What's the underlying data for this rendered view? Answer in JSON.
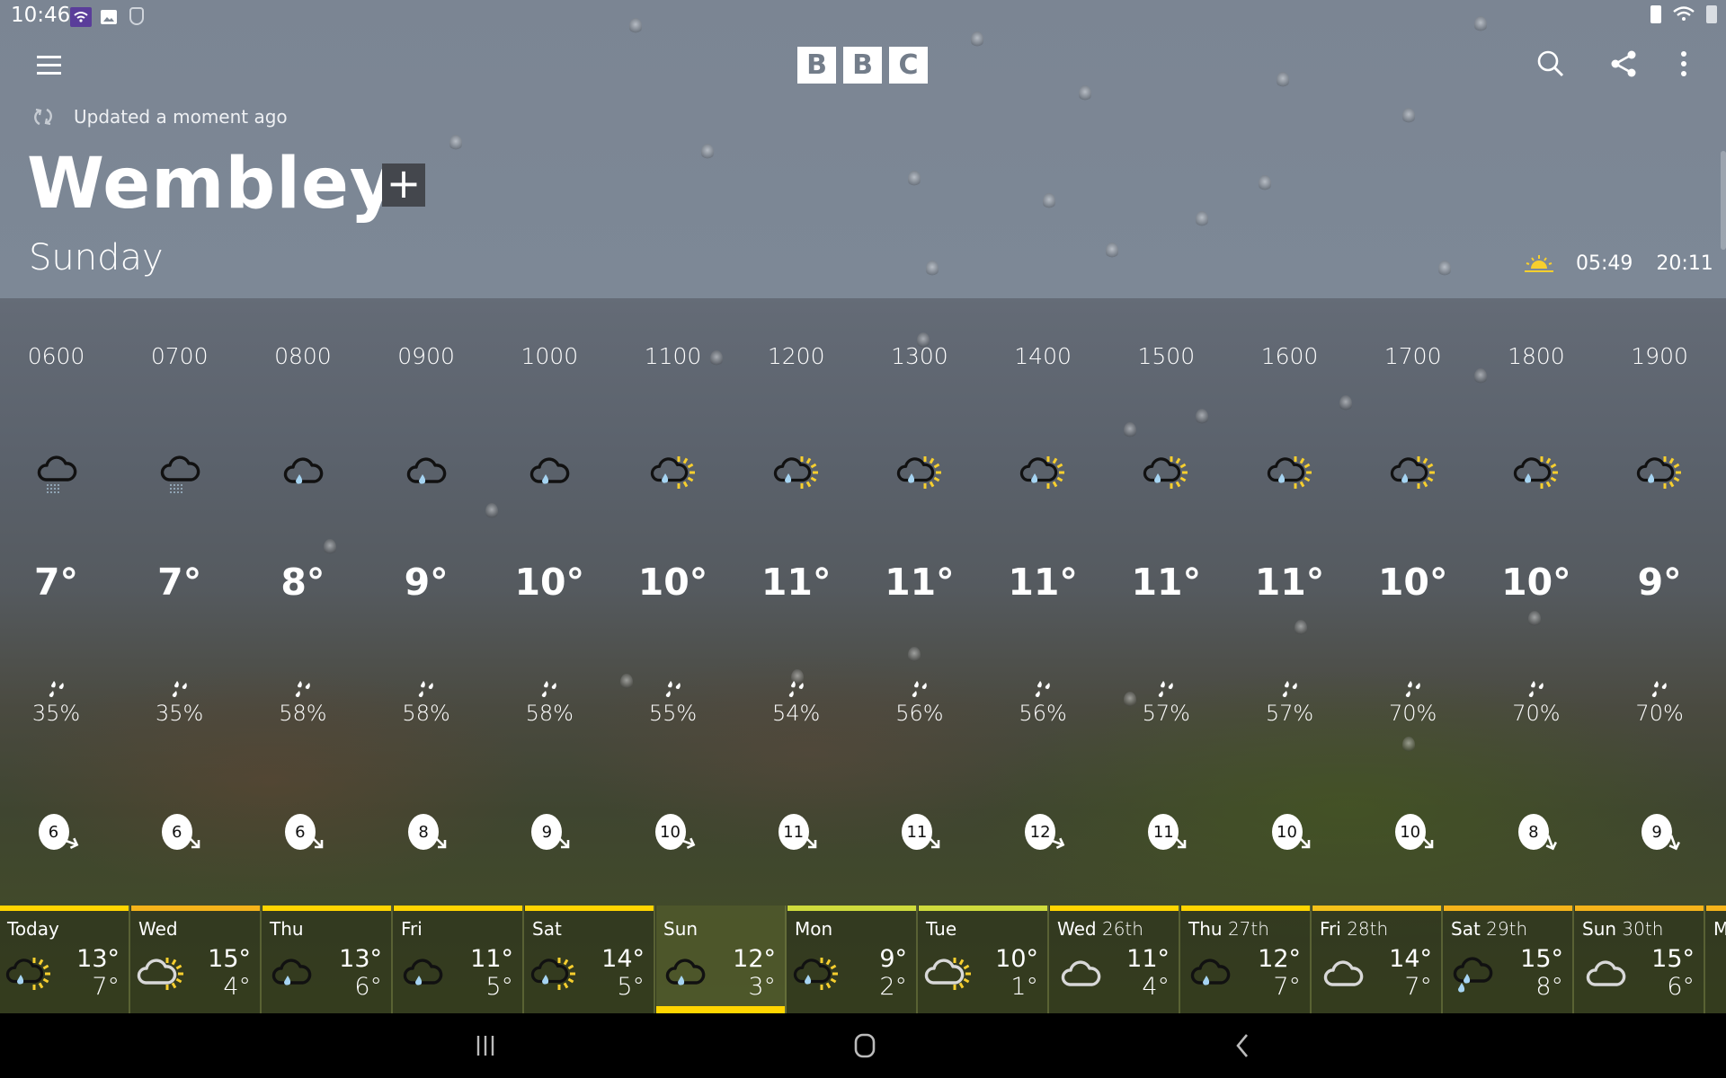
{
  "status_bar": {
    "time": "10:46",
    "icons": [
      "wifi-calling-icon",
      "image-icon",
      "vpn-shield-icon",
      "battery-saver-icon",
      "wifi-signal-icon",
      "battery-icon"
    ]
  },
  "app_bar": {
    "logo": [
      "B",
      "B",
      "C"
    ],
    "menu_icon": "hamburger-menu-icon",
    "search_icon": "search-icon",
    "share_icon": "share-icon",
    "more_icon": "more-vertical-icon"
  },
  "header": {
    "updated_text": "Updated a moment ago",
    "location": "Wembley",
    "add_label": "+",
    "day": "Sunday",
    "sunrise": "05:49",
    "sunset": "20:11"
  },
  "colors": {
    "accent_yellow": "#ffd500",
    "orange": "#f5b31a",
    "lime": "#cfdc3c",
    "rain_blue": "#a6d4f2"
  },
  "hourly": [
    {
      "time": "0600",
      "icon": "light-rain-cloud",
      "temp": "7°",
      "rain": "35%",
      "wind": "6",
      "wind_dir": 110
    },
    {
      "time": "0700",
      "icon": "light-rain-cloud",
      "temp": "7°",
      "rain": "35%",
      "wind": "6",
      "wind_dir": 135
    },
    {
      "time": "0800",
      "icon": "rain-cloud",
      "temp": "8°",
      "rain": "58%",
      "wind": "6",
      "wind_dir": 135
    },
    {
      "time": "0900",
      "icon": "rain-cloud",
      "temp": "9°",
      "rain": "58%",
      "wind": "8",
      "wind_dir": 135
    },
    {
      "time": "1000",
      "icon": "rain-cloud",
      "temp": "10°",
      "rain": "58%",
      "wind": "9",
      "wind_dir": 135
    },
    {
      "time": "1100",
      "icon": "sunny-rain-cloud",
      "temp": "10°",
      "rain": "55%",
      "wind": "10",
      "wind_dir": 110
    },
    {
      "time": "1200",
      "icon": "sunny-rain-cloud",
      "temp": "11°",
      "rain": "54%",
      "wind": "11",
      "wind_dir": 135
    },
    {
      "time": "1300",
      "icon": "sunny-rain-cloud",
      "temp": "11°",
      "rain": "56%",
      "wind": "11",
      "wind_dir": 135
    },
    {
      "time": "1400",
      "icon": "sunny-rain-cloud",
      "temp": "11°",
      "rain": "56%",
      "wind": "12",
      "wind_dir": 110
    },
    {
      "time": "1500",
      "icon": "sunny-rain-cloud",
      "temp": "11°",
      "rain": "57%",
      "wind": "11",
      "wind_dir": 135
    },
    {
      "time": "1600",
      "icon": "sunny-rain-cloud",
      "temp": "11°",
      "rain": "57%",
      "wind": "10",
      "wind_dir": 135
    },
    {
      "time": "1700",
      "icon": "sunny-rain-cloud",
      "temp": "10°",
      "rain": "70%",
      "wind": "10",
      "wind_dir": 135
    },
    {
      "time": "1800",
      "icon": "sunny-rain-cloud",
      "temp": "10°",
      "rain": "70%",
      "wind": "8",
      "wind_dir": 160
    },
    {
      "time": "1900",
      "icon": "sunny-rain-cloud",
      "temp": "9°",
      "rain": "70%",
      "wind": "9",
      "wind_dir": 160
    }
  ],
  "daily": [
    {
      "day": "Today",
      "date": "",
      "icon": "sunny-rain-cloud",
      "max": "13°",
      "min": "7°",
      "bar": "#ffd500",
      "selected": false
    },
    {
      "day": "Wed",
      "date": "",
      "icon": "sunny-white-cloud",
      "max": "15°",
      "min": "4°",
      "bar": "#f5b31a",
      "selected": false
    },
    {
      "day": "Thu",
      "date": "",
      "icon": "rain-cloud",
      "max": "13°",
      "min": "6°",
      "bar": "#ffd500",
      "selected": false
    },
    {
      "day": "Fri",
      "date": "",
      "icon": "rain-cloud",
      "max": "11°",
      "min": "5°",
      "bar": "#ffd500",
      "selected": false
    },
    {
      "day": "Sat",
      "date": "",
      "icon": "sunny-rain-cloud",
      "max": "14°",
      "min": "5°",
      "bar": "#ffd500",
      "selected": false
    },
    {
      "day": "Sun",
      "date": "",
      "icon": "rain-cloud",
      "max": "12°",
      "min": "3°",
      "bar": "",
      "selected": true
    },
    {
      "day": "Mon",
      "date": "",
      "icon": "sunny-rain-cloud",
      "max": "9°",
      "min": "2°",
      "bar": "#cfdc3c",
      "selected": false
    },
    {
      "day": "Tue",
      "date": "",
      "icon": "sunny-white-cloud",
      "max": "10°",
      "min": "1°",
      "bar": "#cfdc3c",
      "selected": false
    },
    {
      "day": "Wed",
      "date": "26th",
      "icon": "white-cloud",
      "max": "11°",
      "min": "4°",
      "bar": "#ffd500",
      "selected": false
    },
    {
      "day": "Thu",
      "date": "27th",
      "icon": "rain-cloud",
      "max": "12°",
      "min": "7°",
      "bar": "#ffd500",
      "selected": false
    },
    {
      "day": "Fri",
      "date": "28th",
      "icon": "white-cloud",
      "max": "14°",
      "min": "7°",
      "bar": "#f5c21a",
      "selected": false
    },
    {
      "day": "Sat",
      "date": "29th",
      "icon": "heavy-rain-cloud",
      "max": "15°",
      "min": "8°",
      "bar": "#f5b31a",
      "selected": false
    },
    {
      "day": "Sun",
      "date": "30th",
      "icon": "white-cloud",
      "max": "15°",
      "min": "6°",
      "bar": "#f5b31a",
      "selected": false
    },
    {
      "day": "M",
      "date": "",
      "icon": "",
      "max": "",
      "min": "",
      "bar": "#f5b31a",
      "selected": false
    }
  ],
  "navbar": {
    "recents_icon": "recents-icon",
    "home_icon": "home-icon",
    "back_icon": "back-icon"
  }
}
